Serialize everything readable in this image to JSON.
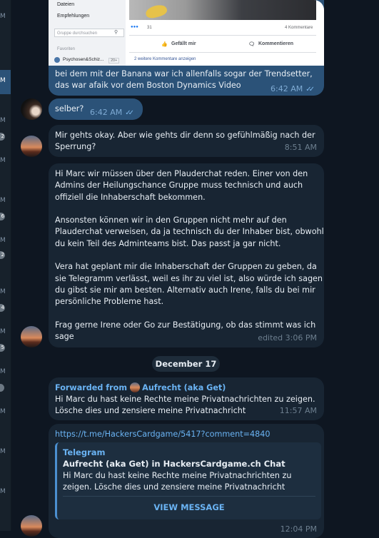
{
  "sidebar": {
    "letters": [
      "M",
      "M",
      "M",
      "M",
      "M",
      "M",
      "M",
      "M",
      "M",
      "M",
      "M",
      "M",
      "M",
      "M"
    ],
    "badges": [
      "2",
      "6",
      "2",
      "4",
      "5"
    ]
  },
  "screenshot": {
    "nav_files": "Dateien",
    "nav_recommendations": "Empfehlungen",
    "search_placeholder": "Gruppe durchsuchen",
    "favorites": "Favoriten",
    "group_name": "Psychosen&Schiz...",
    "group_badge": "20+",
    "reaction_count": "31",
    "comment_count": "4 Kommentare",
    "like_label": "Gefällt mir",
    "comment_label": "Kommentieren",
    "more_comments": "2 weitere Kommentare anzeigen"
  },
  "messages": {
    "m1_text": "bei dem mit der Banana war ich allenfalls sogar der Trendsetter,\ndas war afaik vor dem Boston Dynamics Video",
    "m1_time": "6:42 AM",
    "m2_text": "selber?",
    "m2_time": "6:42 AM",
    "m3_text": "Mir gehts okay. Aber wie gehts dir denn so gefühlmäßig nach der\nSperrung?",
    "m3_time": "8:51 AM",
    "m4_text": "Hi Marc wir müssen über den Plauderchat reden. Einer von den\nAdmins der Heilungschance Gruppe muss technisch und auch\noffiziell die Inhaberschaft bekommen.\n\nAnsonsten können wir in den Gruppen nicht mehr auf den\nPlauderchat verweisen, da ja technisch du der Inhaber bist, obwohl\ndu kein Teil des Adminteams bist. Das passt ja gar nicht.\n\nVera hat geplant mir die Inhaberschaft der Gruppen zu geben, da\nsie Telegramm verlässt, weil es ihr zu viel ist, also würde ich sagen\ndu gibst sie mir am besten. Alternativ auch Irene, falls du bei mir\npersönliche Probleme hast.\n\nFrag gerne Irene oder Go zur Bestätigung, ob das stimmt was ich\nsage",
    "m4_time": "edited 3:06 PM",
    "date_separator": "December 17",
    "m5_forwarded_prefix": "Forwarded from",
    "m5_forwarded_name": "Aufrecht (aka Get)",
    "m5_text": "Hi Marc du hast keine Rechte meine Privatnachrichten zu zeigen.\nLösche dies und zensiere meine Privatnachricht",
    "m5_time": "11:57 AM",
    "m6_link": "https://t.me/HackersCardgame/5417?comment=4840",
    "m6_preview_source": "Telegram",
    "m6_preview_title": "Aufrecht (aka Get) in HackersCardgame.ch Chat",
    "m6_preview_desc": "Hi Marc du hast keine Rechte meine Privatnachrichten zu zeigen.\nLösche dies und zensiere meine Privatnachricht",
    "m6_view_label": "VIEW MESSAGE",
    "m6_time": "12:04 PM"
  }
}
